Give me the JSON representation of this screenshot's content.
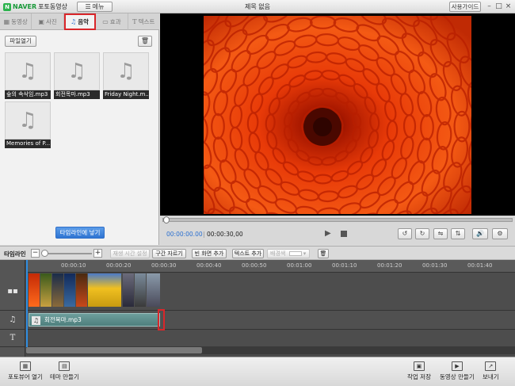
{
  "titlebar": {
    "logo_brand": "NAVER",
    "app_name": "포토동영상",
    "menu_label": "메뉴",
    "doc_title": "제목 없음",
    "guide_label": "사용가이드"
  },
  "tabs": [
    {
      "label": "동영상",
      "icon": "film-icon"
    },
    {
      "label": "사진",
      "icon": "photo-icon"
    },
    {
      "label": "음악",
      "icon": "music-icon",
      "active": true
    },
    {
      "label": "효과",
      "icon": "effect-icon"
    },
    {
      "label": "텍스트",
      "icon": "text-icon"
    }
  ],
  "library": {
    "open_file_label": "파일열기",
    "files": [
      {
        "name": "숲의 속삭임.mp3"
      },
      {
        "name": "회전목마.mp3"
      },
      {
        "name": "Friday Night.m..."
      },
      {
        "name": "Memories of P..."
      }
    ],
    "add_to_timeline_label": "타임라인에 넣기"
  },
  "player": {
    "current_time": "00:00:00.00",
    "separator": "|",
    "total_time": "00:00:30,00",
    "progress": 0
  },
  "timeline_toolbar": {
    "label": "타임라인",
    "zoom_out": "−",
    "zoom_in": "+",
    "buttons": [
      {
        "label": "재생 시간 설정",
        "enabled": false
      },
      {
        "label": "구간 자르기",
        "enabled": true
      },
      {
        "label": "빈 화면 추가",
        "enabled": true
      },
      {
        "label": "텍스트 추가",
        "enabled": true
      },
      {
        "label": "배경색",
        "enabled": false
      }
    ]
  },
  "ruler": {
    "ticks": [
      "00:00:10",
      "00:00:20",
      "00:00:30",
      "00:00:40",
      "00:00:50",
      "00:01:00",
      "00:01:10",
      "00:01:20",
      "00:01:30",
      "00:01:40"
    ]
  },
  "tracks": {
    "audio_clip_name": "회전목마.mp3"
  },
  "bottom": {
    "tour": "포토뷰어 열기",
    "theme": "테마 만들기",
    "save": "작업 저장",
    "make_video": "동영상 만들기",
    "send": "보내기"
  },
  "colors": {
    "accent_blue": "#2f74d2",
    "highlight_red": "#d9262a",
    "audio_clip": "#5e8f8d"
  }
}
